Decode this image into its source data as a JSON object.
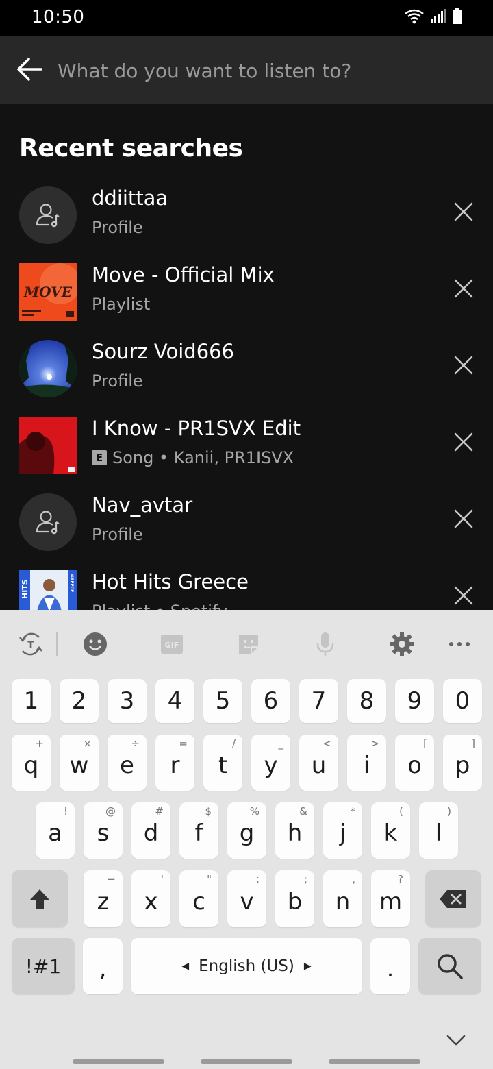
{
  "status_bar": {
    "time": "10:50"
  },
  "search": {
    "placeholder": "What do you want to listen to?"
  },
  "recent": {
    "title": "Recent searches",
    "items": [
      {
        "title": "ddiittaa",
        "subtitle": "Profile",
        "type": "profile"
      },
      {
        "title": "Move - Official Mix",
        "subtitle": "Playlist",
        "type": "playlist-move"
      },
      {
        "title": "Sourz Void666",
        "subtitle": "Profile",
        "type": "profile-photo"
      },
      {
        "title": "I Know - PR1SVX Edit",
        "subtitle": "Song • Kanii, PR1ISVX",
        "explicit": "E",
        "type": "song"
      },
      {
        "title": "Nav_avtar",
        "subtitle": "Profile",
        "type": "profile"
      },
      {
        "title": "Hot Hits Greece",
        "subtitle": "Playlist • Spotify",
        "type": "playlist-greece"
      }
    ]
  },
  "cover_art": {
    "move": "MOVE",
    "greece": [
      "HITS",
      "GREECE"
    ]
  },
  "keyboard": {
    "numbers": [
      "1",
      "2",
      "3",
      "4",
      "5",
      "6",
      "7",
      "8",
      "9",
      "0"
    ],
    "row1": [
      {
        "k": "q",
        "s": "+"
      },
      {
        "k": "w",
        "s": "×"
      },
      {
        "k": "e",
        "s": "÷"
      },
      {
        "k": "r",
        "s": "="
      },
      {
        "k": "t",
        "s": "/"
      },
      {
        "k": "y",
        "s": "_"
      },
      {
        "k": "u",
        "s": "<"
      },
      {
        "k": "i",
        "s": ">"
      },
      {
        "k": "o",
        "s": "["
      },
      {
        "k": "p",
        "s": "]"
      }
    ],
    "row2": [
      {
        "k": "a",
        "s": "!"
      },
      {
        "k": "s",
        "s": "@"
      },
      {
        "k": "d",
        "s": "#"
      },
      {
        "k": "f",
        "s": "$"
      },
      {
        "k": "g",
        "s": "%"
      },
      {
        "k": "h",
        "s": "&"
      },
      {
        "k": "j",
        "s": "*"
      },
      {
        "k": "k",
        "s": "("
      },
      {
        "k": "l",
        "s": ")"
      }
    ],
    "row3": [
      {
        "k": "z",
        "s": "−"
      },
      {
        "k": "x",
        "s": "'"
      },
      {
        "k": "c",
        "s": "\""
      },
      {
        "k": "v",
        "s": ":"
      },
      {
        "k": "b",
        "s": ";"
      },
      {
        "k": "n",
        "s": ","
      },
      {
        "k": "m",
        "s": "?"
      }
    ],
    "symbols_label": "!#1",
    "comma_label": ",",
    "space_label": "English (US)",
    "period_label": ".",
    "gif_label": "GIF"
  },
  "colors": {
    "background": "#121212",
    "search_bar": "#282828",
    "keyboard": "#e4e4e4"
  }
}
